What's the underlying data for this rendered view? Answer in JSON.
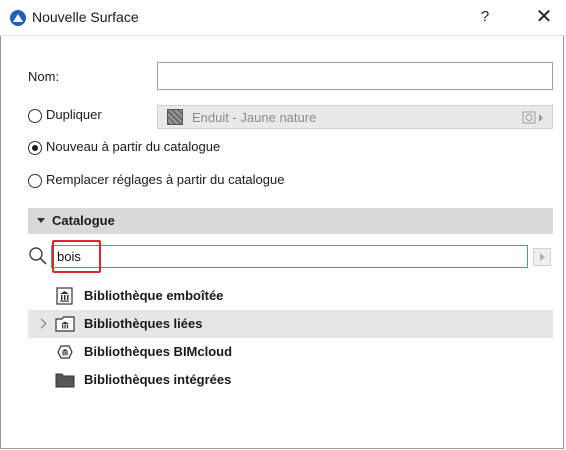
{
  "window": {
    "title": "Nouvelle Surface",
    "help_label": "?",
    "close_label": "✕"
  },
  "form": {
    "nom_label": "Nom:",
    "nom_value": "",
    "options": [
      {
        "label": "Dupliquer",
        "checked": false
      },
      {
        "label": "Nouveau à partir du catalogue",
        "checked": true
      },
      {
        "label": "Remplacer réglages à partir du catalogue",
        "checked": false
      }
    ],
    "duplicate_source": "Enduit - Jaune nature"
  },
  "catalogue": {
    "section_title": "Catalogue",
    "search_value": "bois",
    "items": [
      {
        "label": "Bibliothèque emboîtée",
        "icon": "library-icon",
        "expandable": false,
        "selected": false
      },
      {
        "label": "Bibliothèques liées",
        "icon": "linked-library-icon",
        "expandable": true,
        "selected": true
      },
      {
        "label": "Bibliothèques BIMcloud",
        "icon": "bimcloud-library-icon",
        "expandable": false,
        "selected": false
      },
      {
        "label": "Bibliothèques intégrées",
        "icon": "folder-icon",
        "expandable": false,
        "selected": false
      }
    ]
  },
  "colors": {
    "accent": "#4a90d9",
    "highlight": "#e0252a",
    "section_bg": "#d9d9d9"
  }
}
